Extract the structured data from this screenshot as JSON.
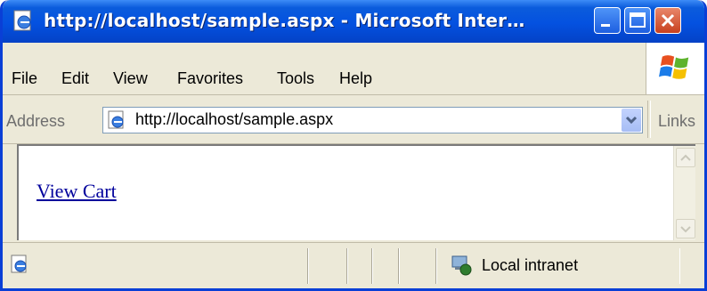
{
  "window": {
    "title": "http://localhost/sample.aspx - Microsoft Inter…"
  },
  "menu": {
    "items": [
      "File",
      "Edit",
      "View",
      "Favorites",
      "Tools",
      "Help"
    ]
  },
  "address_bar": {
    "label": "Address",
    "value": "http://localhost/sample.aspx",
    "links_label": "Links"
  },
  "content": {
    "link_text": "View Cart"
  },
  "status_bar": {
    "zone": "Local intranet"
  },
  "colors": {
    "titlebar": "#0451e0",
    "link": "#00009c",
    "close_button": "#c8401e"
  },
  "icons": [
    "ie-page-icon",
    "minimize-icon",
    "maximize-icon",
    "close-icon",
    "windows-logo-icon",
    "dropdown-arrow-icon",
    "scroll-up-icon",
    "scroll-down-icon",
    "page-done-icon",
    "local-intranet-icon"
  ]
}
